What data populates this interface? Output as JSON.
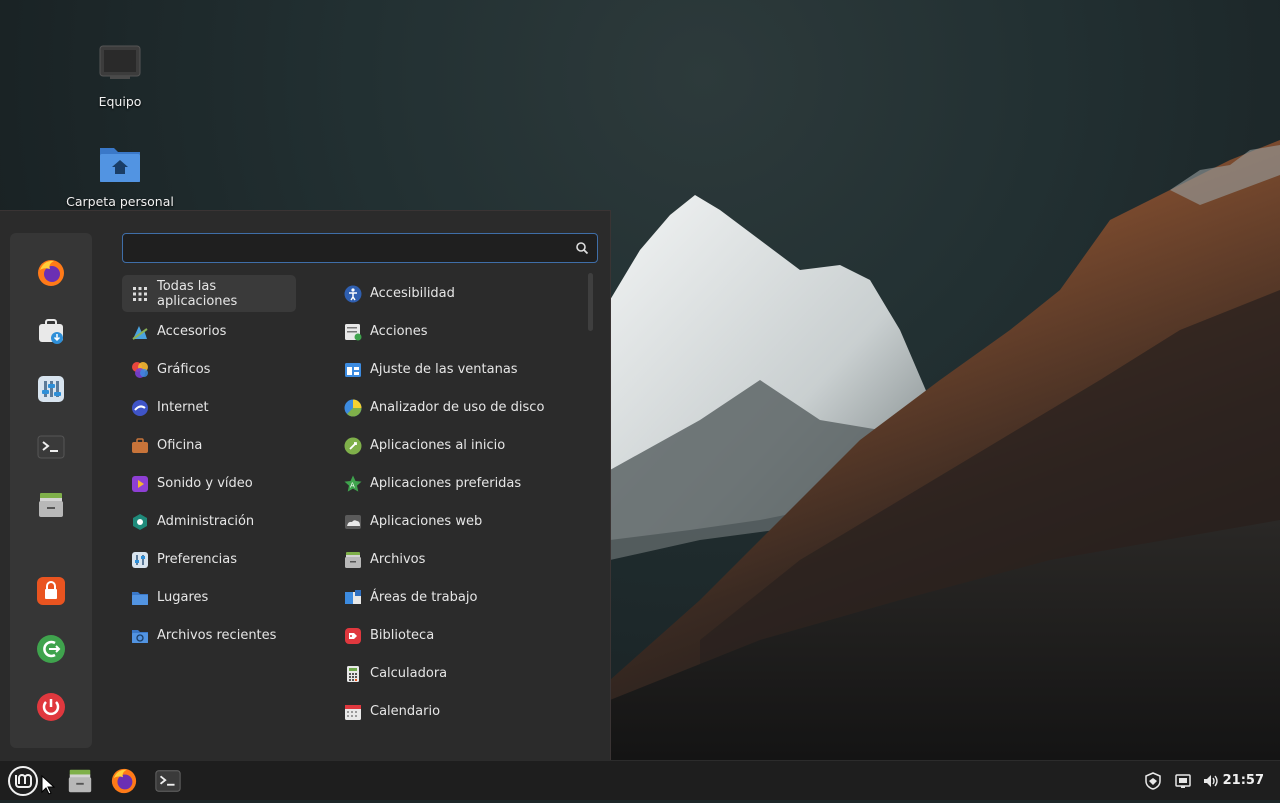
{
  "desktop": {
    "icons": [
      {
        "label": "Equipo",
        "icon": "computer-icon"
      },
      {
        "label": "Carpeta personal",
        "icon": "home-folder-icon"
      }
    ]
  },
  "menu": {
    "search": {
      "value": "",
      "placeholder": ""
    },
    "favorites": [
      {
        "name": "firefox",
        "icon": "firefox-icon"
      },
      {
        "name": "software-manager",
        "icon": "software-manager-icon"
      },
      {
        "name": "system-settings",
        "icon": "settings-icon"
      },
      {
        "name": "terminal",
        "icon": "terminal-icon"
      },
      {
        "name": "files",
        "icon": "files-icon"
      },
      {
        "name": "lock-screen",
        "icon": "lock-icon"
      },
      {
        "name": "logout",
        "icon": "logout-icon"
      },
      {
        "name": "shutdown",
        "icon": "power-icon"
      }
    ],
    "categories": [
      {
        "label": "Todas las aplicaciones",
        "icon": "grid-icon",
        "selected": true
      },
      {
        "label": "Accesorios",
        "icon": "accessories-icon"
      },
      {
        "label": "Gráficos",
        "icon": "graphics-icon"
      },
      {
        "label": "Internet",
        "icon": "internet-icon"
      },
      {
        "label": "Oficina",
        "icon": "office-icon"
      },
      {
        "label": "Sonido y vídeo",
        "icon": "multimedia-icon"
      },
      {
        "label": "Administración",
        "icon": "administration-icon"
      },
      {
        "label": "Preferencias",
        "icon": "preferences-icon"
      },
      {
        "label": "Lugares",
        "icon": "places-icon"
      },
      {
        "label": "Archivos recientes",
        "icon": "recent-files-icon"
      }
    ],
    "apps": [
      {
        "label": "Accesibilidad",
        "icon": "accessibility-icon"
      },
      {
        "label": "Acciones",
        "icon": "actions-icon"
      },
      {
        "label": "Ajuste de las ventanas",
        "icon": "window-tiling-icon"
      },
      {
        "label": "Analizador de uso de disco",
        "icon": "disk-usage-icon"
      },
      {
        "label": "Aplicaciones al inicio",
        "icon": "startup-apps-icon"
      },
      {
        "label": "Aplicaciones preferidas",
        "icon": "preferred-apps-icon"
      },
      {
        "label": "Aplicaciones web",
        "icon": "web-apps-icon"
      },
      {
        "label": "Archivos",
        "icon": "files-icon"
      },
      {
        "label": "Áreas de trabajo",
        "icon": "workspaces-icon"
      },
      {
        "label": "Biblioteca",
        "icon": "library-icon"
      },
      {
        "label": "Calculadora",
        "icon": "calculator-icon"
      },
      {
        "label": "Calendario",
        "icon": "calendar-icon"
      }
    ]
  },
  "panel": {
    "launchers": [
      {
        "name": "menu",
        "icon": "mint-logo-icon"
      },
      {
        "name": "files",
        "icon": "files-icon"
      },
      {
        "name": "firefox",
        "icon": "firefox-icon"
      },
      {
        "name": "terminal",
        "icon": "terminal-icon"
      }
    ],
    "tray": [
      {
        "name": "update-manager",
        "icon": "shield-icon"
      },
      {
        "name": "network",
        "icon": "network-icon"
      },
      {
        "name": "volume",
        "icon": "volume-icon"
      }
    ],
    "clock": "21:57"
  },
  "colors": {
    "menu_bg": "#2b2b2b",
    "favbar_bg": "#363636",
    "accent": "#3f6ea8",
    "panel_bg": "#1e1e1e",
    "mint_green": "#8bb158"
  }
}
